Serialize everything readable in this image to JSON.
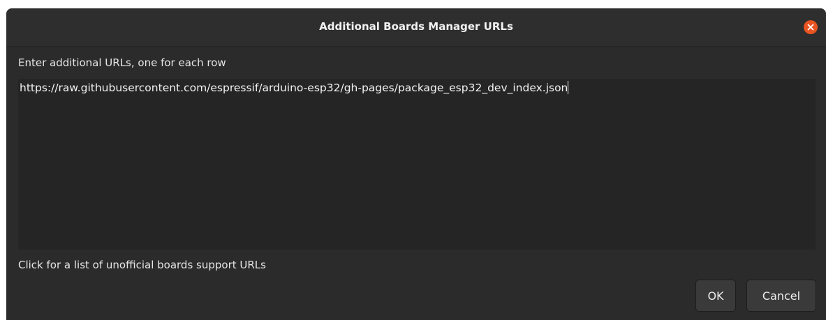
{
  "dialog": {
    "title": "Additional Boards Manager URLs",
    "prompt": "Enter additional URLs, one for each row",
    "urls_text": "https://raw.githubusercontent.com/espressif/arduino-esp32/gh-pages/package_esp32_dev_index.json",
    "link_text": "Click for a list of unofficial boards support URLs",
    "ok_label": "OK",
    "cancel_label": "Cancel",
    "close_icon": "close-icon",
    "accent_color": "#e95420"
  }
}
